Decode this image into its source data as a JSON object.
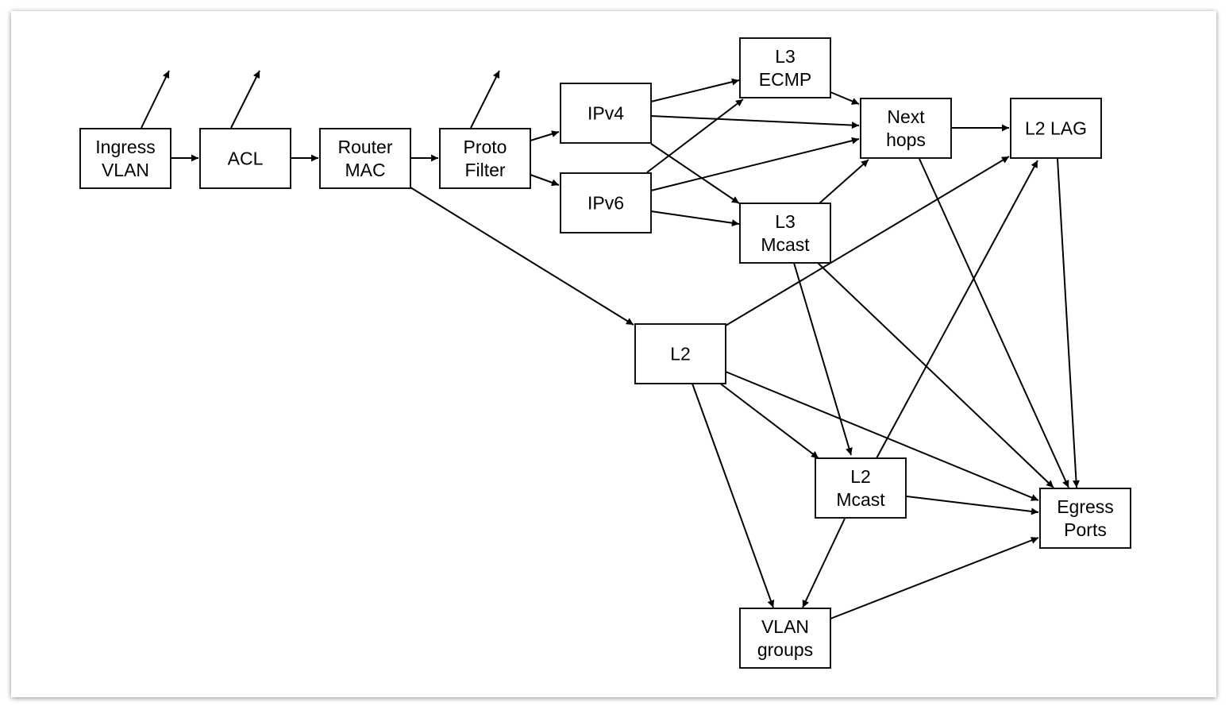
{
  "diagram": {
    "nodes": [
      {
        "id": "ingress",
        "lines": [
          "Ingress",
          "VLAN"
        ]
      },
      {
        "id": "acl",
        "lines": [
          "ACL"
        ]
      },
      {
        "id": "router",
        "lines": [
          "Router",
          "MAC"
        ]
      },
      {
        "id": "proto",
        "lines": [
          "Proto",
          "Filter"
        ]
      },
      {
        "id": "ipv4",
        "lines": [
          "IPv4"
        ]
      },
      {
        "id": "ipv6",
        "lines": [
          "IPv6"
        ]
      },
      {
        "id": "ecmp",
        "lines": [
          "L3",
          "ECMP"
        ]
      },
      {
        "id": "mcast3",
        "lines": [
          "L3",
          "Mcast"
        ]
      },
      {
        "id": "next",
        "lines": [
          "Next",
          "hops"
        ]
      },
      {
        "id": "lag",
        "lines": [
          "L2 LAG"
        ]
      },
      {
        "id": "l2",
        "lines": [
          "L2"
        ]
      },
      {
        "id": "mcast2",
        "lines": [
          "L2",
          "Mcast"
        ]
      },
      {
        "id": "egress",
        "lines": [
          "Egress",
          "Ports"
        ]
      },
      {
        "id": "vlan",
        "lines": [
          "VLAN",
          "groups"
        ]
      }
    ],
    "edges": [
      [
        "ingress",
        "acl"
      ],
      [
        "acl",
        "router"
      ],
      [
        "router",
        "proto"
      ],
      [
        "proto",
        "ipv4"
      ],
      [
        "proto",
        "ipv6"
      ],
      [
        "ingress",
        "out"
      ],
      [
        "acl",
        "out"
      ],
      [
        "proto",
        "out"
      ],
      [
        "ipv4",
        "ecmp"
      ],
      [
        "ipv4",
        "next"
      ],
      [
        "ipv4",
        "mcast3"
      ],
      [
        "ipv6",
        "ecmp"
      ],
      [
        "ipv6",
        "next"
      ],
      [
        "ipv6",
        "mcast3"
      ],
      [
        "ecmp",
        "next"
      ],
      [
        "mcast3",
        "next"
      ],
      [
        "next",
        "lag"
      ],
      [
        "next",
        "egress"
      ],
      [
        "lag",
        "egress"
      ],
      [
        "router",
        "l2"
      ],
      [
        "l2",
        "lag"
      ],
      [
        "l2",
        "egress"
      ],
      [
        "l2",
        "mcast2"
      ],
      [
        "l2",
        "vlan"
      ],
      [
        "mcast3",
        "mcast2"
      ],
      [
        "mcast3",
        "egress"
      ],
      [
        "mcast2",
        "lag"
      ],
      [
        "mcast2",
        "egress"
      ],
      [
        "mcast2",
        "vlan"
      ],
      [
        "vlan",
        "egress"
      ]
    ]
  }
}
